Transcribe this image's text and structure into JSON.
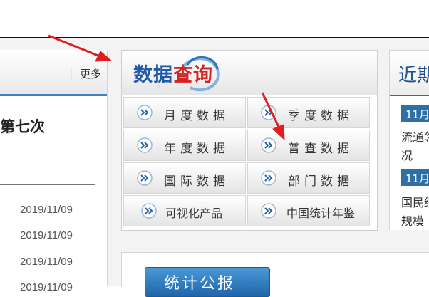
{
  "left_panel": {
    "more_label": "｜ 更多",
    "headline": "第七次",
    "dates": [
      "2019/11/09",
      "2019/11/09",
      "2019/11/09",
      "2019/11/09"
    ]
  },
  "data_query": {
    "title_part1": "数据",
    "title_part2": "查询",
    "items": [
      {
        "label": "月度数据"
      },
      {
        "label": "季度数据"
      },
      {
        "label": "年度数据"
      },
      {
        "label": "普查数据"
      },
      {
        "label": "国际数据"
      },
      {
        "label": "部门数据"
      },
      {
        "label": "可视化产品"
      },
      {
        "label": "中国统计年鉴"
      }
    ]
  },
  "right_panel": {
    "title": "近期",
    "tag1": "11月",
    "line1": "流通领",
    "line2": "况",
    "tag2": "11月",
    "line3": "国民经",
    "line4": "规模"
  },
  "bottom_panel": {
    "button_label": "统计公报"
  },
  "colors": {
    "brand_blue": "#1f5aa8",
    "brand_red": "#d42424",
    "tag_blue": "#2f6fa6",
    "arrow_red": "#e01e1e"
  }
}
